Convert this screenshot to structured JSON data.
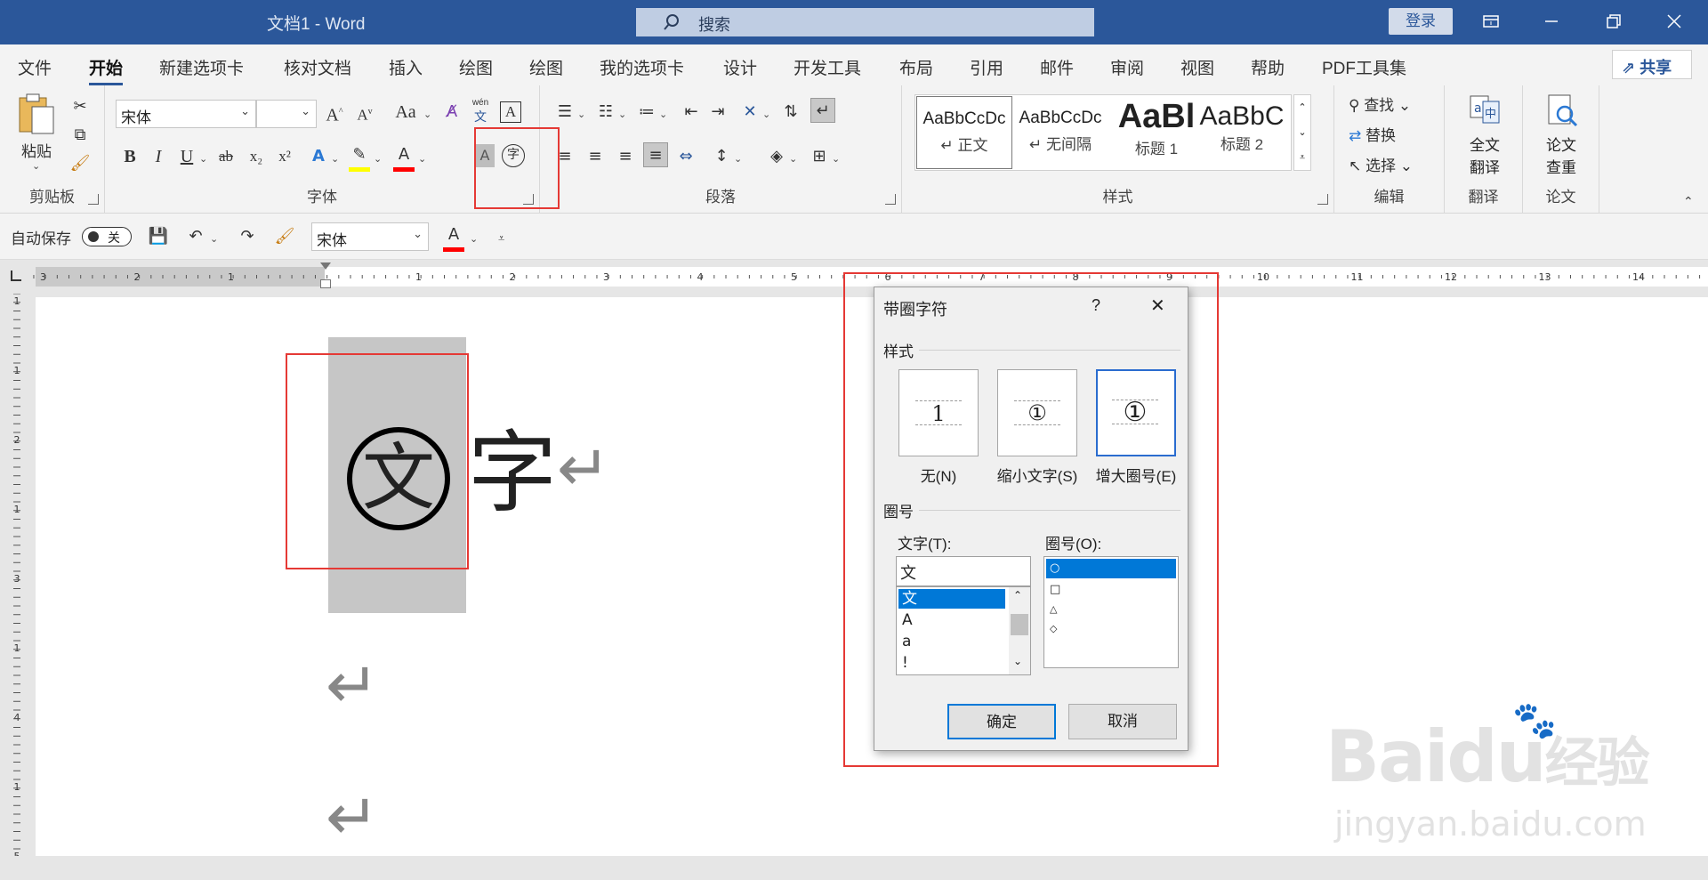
{
  "window": {
    "title": "文档1  -  Word",
    "search_placeholder": "搜索",
    "login": "登录"
  },
  "tabs": [
    "文件",
    "开始",
    "新建选项卡",
    "核对文档",
    "插入",
    "绘图",
    "绘图",
    "我的选项卡",
    "设计",
    "开发工具",
    "布局",
    "引用",
    "邮件",
    "审阅",
    "视图",
    "帮助",
    "PDF工具集"
  ],
  "active_tab": "开始",
  "share_label": "共享",
  "ribbon": {
    "clipboard": {
      "paste": "粘贴",
      "group": "剪贴板"
    },
    "font": {
      "name": "宋体",
      "size": "",
      "group": "字体",
      "bold": "B",
      "italic": "I",
      "underline": "U",
      "strike": "ab",
      "sub": "x₂",
      "sup": "x²",
      "grow": "A",
      "shrink": "A",
      "case": "Aa",
      "wen": "wén",
      "wen2": "文",
      "enclose": "字",
      "shade": "A",
      "highlight_color": "#ffff00",
      "font_color": "#ff0000"
    },
    "paragraph": {
      "group": "段落"
    },
    "styles": {
      "group": "样式",
      "items": [
        {
          "sample": "AaBbCcDc",
          "name": "↵ 正文"
        },
        {
          "sample": "AaBbCcDc",
          "name": "↵ 无间隔"
        },
        {
          "sample": "AaBl",
          "name": "标题 1"
        },
        {
          "sample": "AaBbC",
          "name": "标题 2"
        }
      ]
    },
    "editing": {
      "find": "查找",
      "replace": "替换",
      "select": "选择",
      "group": "编辑"
    },
    "translate": {
      "label1": "全文",
      "label2": "翻译",
      "group": "翻译"
    },
    "paper": {
      "label1": "论文",
      "label2": "查重",
      "group": "论文"
    }
  },
  "qat": {
    "autosave": "自动保存",
    "toggle": "关",
    "font": "宋体"
  },
  "ruler": {
    "h_left": [
      "3",
      "2",
      "1"
    ],
    "h_right": [
      "1",
      "2",
      "3",
      "4",
      "5",
      "6",
      "7",
      "8",
      "9",
      "10",
      "11",
      "12",
      "13",
      "14"
    ],
    "v": [
      "1",
      "1",
      "2",
      "1",
      "3",
      "1",
      "4",
      "1",
      "5"
    ]
  },
  "document": {
    "circled_char": "文",
    "next_char": "字",
    "para_mark": "↵"
  },
  "dialog": {
    "title": "带圈字符",
    "help": "?",
    "close": "✕",
    "style_section": "样式",
    "options": [
      {
        "label": "无(N)",
        "preview": "1"
      },
      {
        "label": "缩小文字(S)",
        "preview": "①"
      },
      {
        "label": "增大圈号(E)",
        "preview": "①"
      }
    ],
    "selected_option": 2,
    "enclosure_section": "圈号",
    "text_label": "文字(T):",
    "text_value": "文",
    "text_list": [
      "文",
      "A",
      "a",
      "!"
    ],
    "circle_label": "圈号(O):",
    "circle_list": [
      "○",
      "□",
      "△",
      "◇"
    ],
    "ok": "确定",
    "cancel": "取消"
  },
  "watermark": {
    "brand": "Baidu",
    "suffix": "经验",
    "url": "jingyan.baidu.com"
  },
  "colors": {
    "title_blue": "#2b579a",
    "highlight_red": "#e53935",
    "selection_blue": "#0078d7"
  }
}
